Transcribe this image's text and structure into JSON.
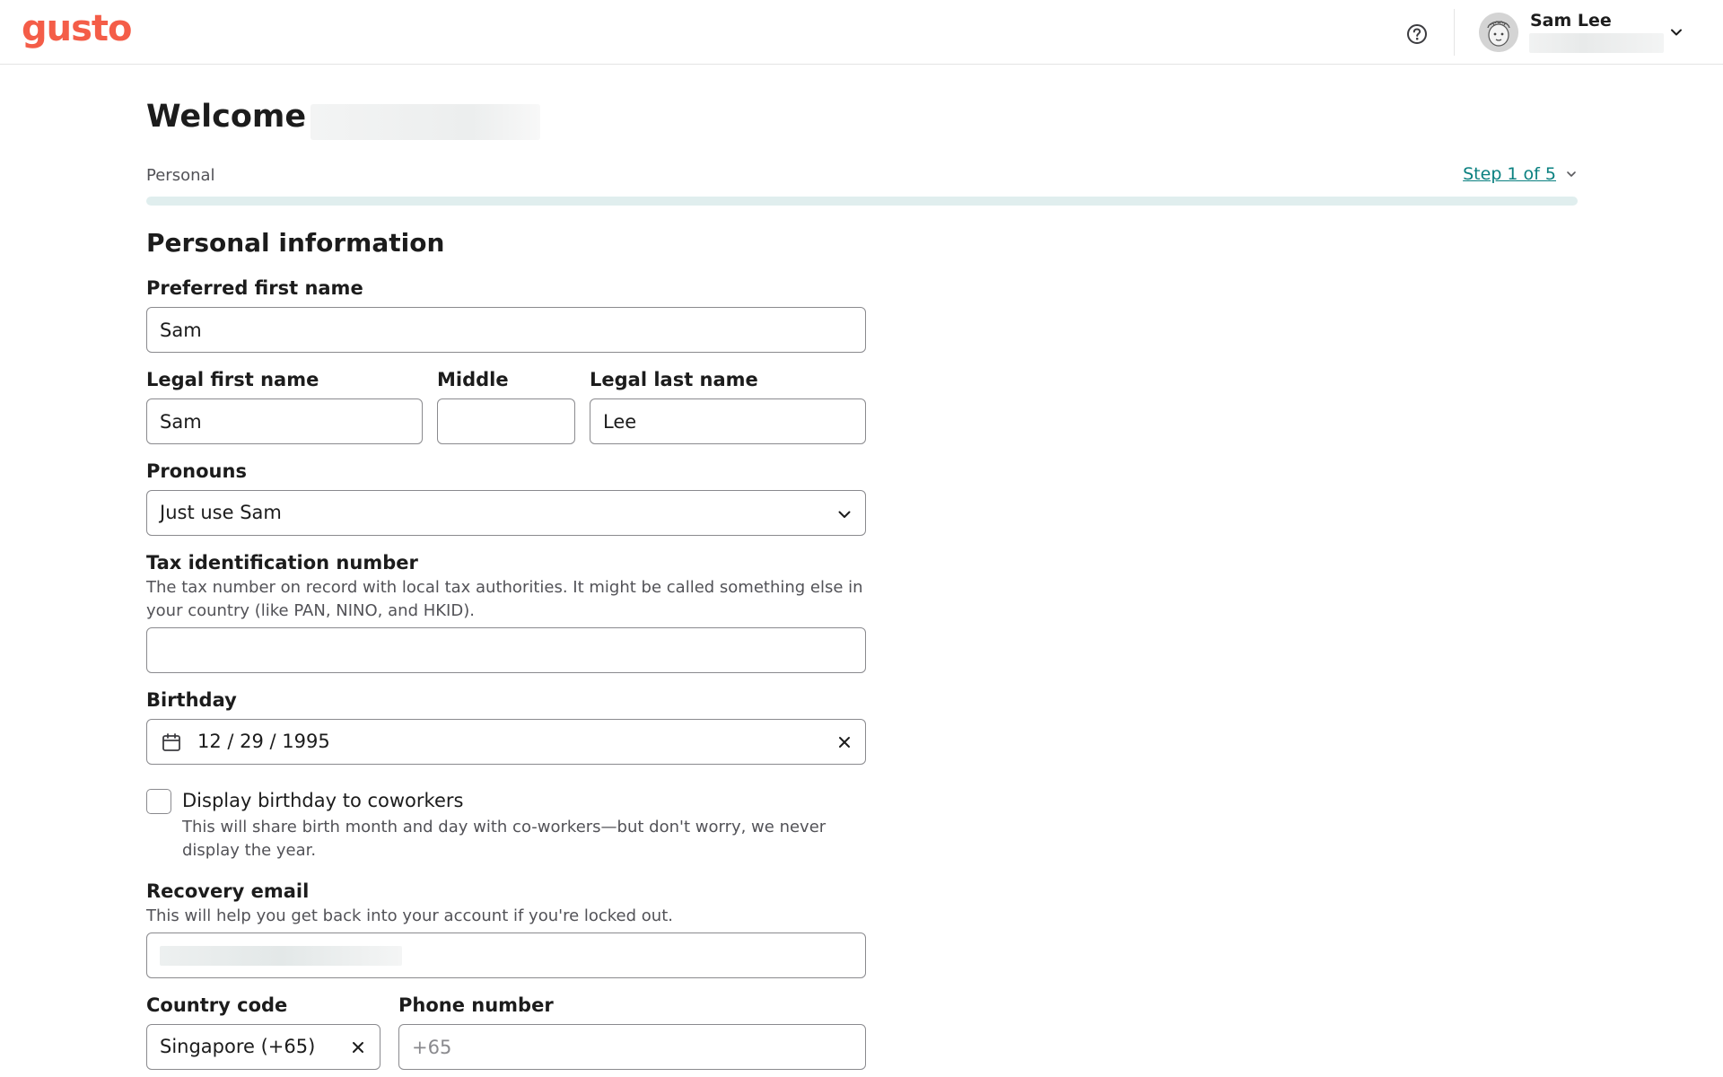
{
  "app": {
    "logo_text": "gusto",
    "brand_color": "#f45d48",
    "accent_color": "#0a8080"
  },
  "header": {
    "help_icon": "question-circle-icon",
    "user": {
      "name": "Sam Lee",
      "avatar_icon": "avatar-illustration",
      "menu_icon": "chevron-down-icon"
    }
  },
  "welcome": {
    "title": "Welcome to"
  },
  "progress": {
    "section_label": "Personal",
    "step_text": "Step 1 of 5",
    "current_step": 1,
    "total_steps": 5
  },
  "form": {
    "title": "Personal information",
    "preferred_first_name": {
      "label": "Preferred first name",
      "value": "Sam"
    },
    "legal_first_name": {
      "label": "Legal first name",
      "value": "Sam"
    },
    "middle_name": {
      "label": "Middle",
      "value": ""
    },
    "legal_last_name": {
      "label": "Legal last name",
      "value": "Lee"
    },
    "pronouns": {
      "label": "Pronouns",
      "value": "Just use Sam"
    },
    "tax_id": {
      "label": "Tax identification number",
      "hint_line1": "The tax number on record with local tax authorities. It might be called something else in",
      "hint_line2": "your country (like PAN, NINO, and HKID).",
      "value": ""
    },
    "birthday": {
      "label": "Birthday",
      "value": "12 / 29 / 1995"
    },
    "display_birthday": {
      "label": "Display birthday to coworkers",
      "checked": false,
      "hint_line1": "This will share birth month and day with co-workers—but don't worry, we never",
      "hint_line2": "display the year."
    },
    "recovery_email": {
      "label": "Recovery email",
      "hint": "This will help you get back into your account if you're locked out."
    },
    "country_code": {
      "label": "Country code",
      "value": "Singapore (+65)"
    },
    "phone_number": {
      "label": "Phone number",
      "placeholder": "+65",
      "value": ""
    }
  }
}
